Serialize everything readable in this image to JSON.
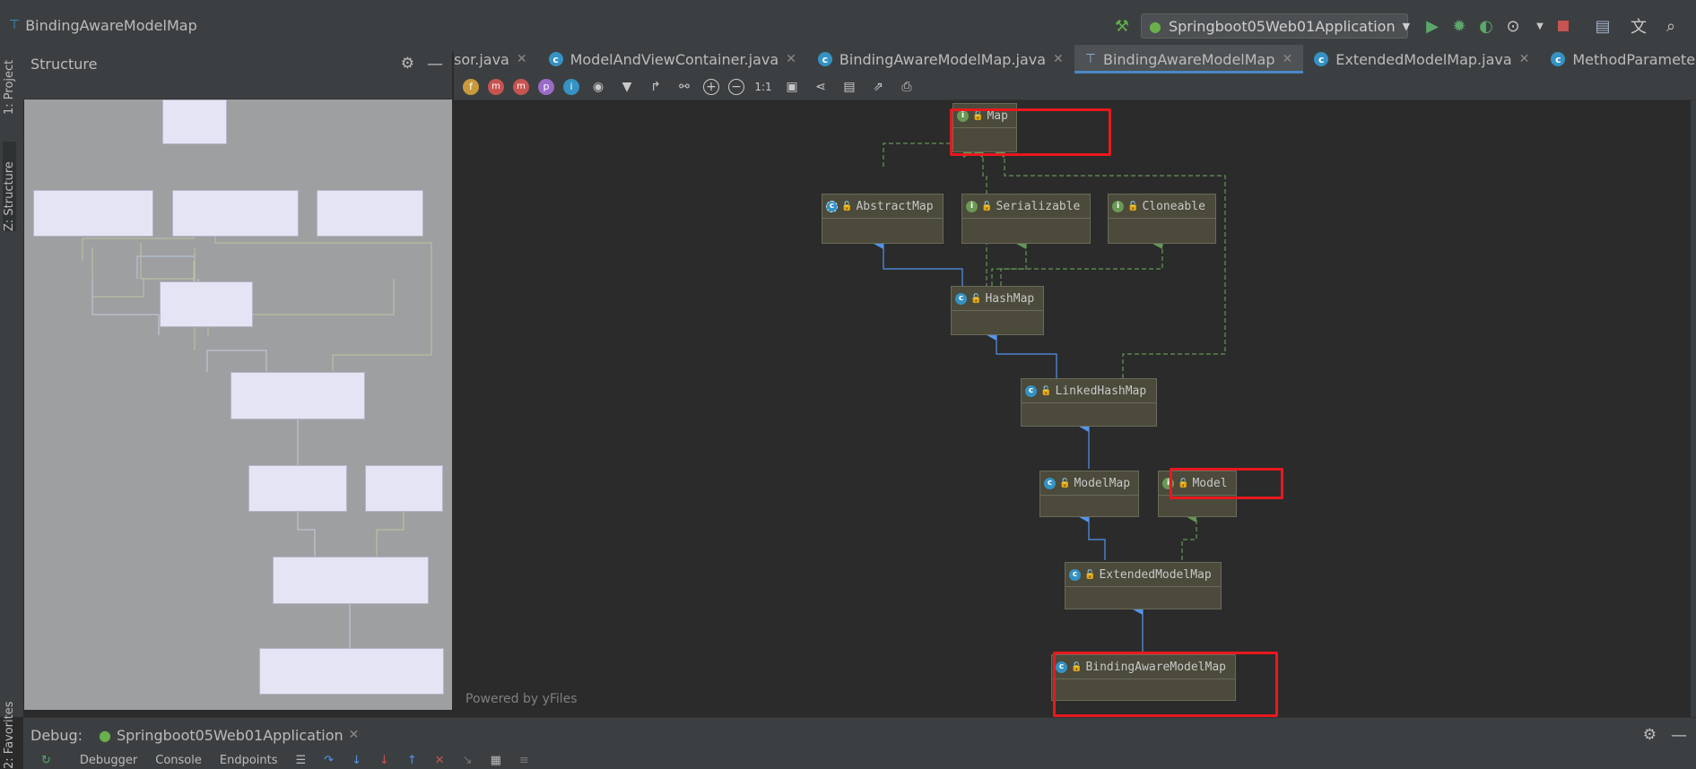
{
  "window": {
    "breadcrumb_title": "BindingAwareModelMap",
    "run_config": "Springboot05Web01Application"
  },
  "left_stripe": {
    "project_tab": "1: Project",
    "structure_tab": "Z: Structure",
    "favorites_tab": "2: Favorites"
  },
  "structure_panel": {
    "title": "Structure"
  },
  "editor_tabs": [
    {
      "label": "sor.java",
      "icon": "none",
      "active": false
    },
    {
      "label": "ModelAndViewContainer.java",
      "icon": "class-icon",
      "active": false
    },
    {
      "label": "BindingAwareModelMap.java",
      "icon": "class-icon",
      "active": false
    },
    {
      "label": "BindingAwareModelMap",
      "icon": "diagram-icon",
      "active": true
    },
    {
      "label": "ExtendedModelMap.java",
      "icon": "class-icon",
      "active": false
    },
    {
      "label": "MethodParameter.java",
      "icon": "class-icon",
      "active": false
    }
  ],
  "diagram_toolbar": {
    "icons": [
      "fields-icon",
      "constructors-icon",
      "methods-icon",
      "properties-icon",
      "inner-classes-icon",
      "visibility-icon",
      "filter-icon",
      "route-icon",
      "link-icon",
      "zoom-in-icon",
      "zoom-out-icon",
      "actual-size-icon",
      "fit-content-icon",
      "layout-icon",
      "save-icon",
      "export-icon",
      "print-icon"
    ],
    "actual_size_label": "1:1"
  },
  "diagram": {
    "powered_by": "Powered by yFiles",
    "nodes": {
      "map": {
        "name": "Map",
        "kind": "interface"
      },
      "abstract_map": {
        "name": "AbstractMap",
        "kind": "abstract-class"
      },
      "serializable": {
        "name": "Serializable",
        "kind": "interface"
      },
      "cloneable": {
        "name": "Cloneable",
        "kind": "interface"
      },
      "hash_map": {
        "name": "HashMap",
        "kind": "class"
      },
      "linked_hash_map": {
        "name": "LinkedHashMap",
        "kind": "class"
      },
      "model_map": {
        "name": "ModelMap",
        "kind": "class"
      },
      "model": {
        "name": "Model",
        "kind": "interface"
      },
      "extended_model_map": {
        "name": "ExtendedModelMap",
        "kind": "class"
      },
      "binding_aware_model_map": {
        "name": "BindingAwareModelMap",
        "kind": "class"
      }
    },
    "colors": {
      "extends_edge": "#5394ec",
      "implements_edge": "#629755",
      "highlight": "#e8191e"
    }
  },
  "debug": {
    "label": "Debug:",
    "session": "Springboot05Web01Application",
    "tabs": [
      "Debugger",
      "Console",
      "Endpoints"
    ]
  }
}
